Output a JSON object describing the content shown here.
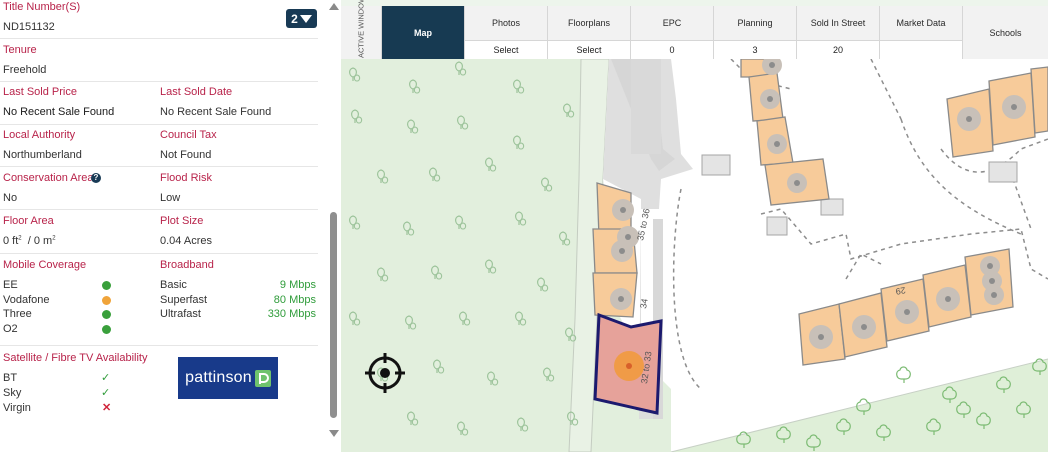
{
  "property": {
    "title_number_label": "Title Number(S)",
    "title_number_value": "ND151132",
    "title_count": "2",
    "tenure_label": "Tenure",
    "tenure_value": "Freehold",
    "last_sold_price_label": "Last Sold Price",
    "last_sold_price_value": "No Recent Sale Found",
    "last_sold_date_label": "Last Sold Date",
    "last_sold_date_value": "No Recent Sale Found",
    "local_authority_label": "Local Authority",
    "local_authority_value": "Northumberland",
    "council_tax_label": "Council Tax",
    "council_tax_value": "Not Found",
    "conservation_area_label": "Conservation Area",
    "conservation_area_value": "No",
    "flood_risk_label": "Flood Risk",
    "flood_risk_value": "Low",
    "floor_area_label": "Floor Area",
    "floor_area_ft": "0 ft",
    "floor_area_m": "/ 0 m",
    "floor_area_sup": "2",
    "plot_size_label": "Plot Size",
    "plot_size_value": "0.04 Acres"
  },
  "mobile": {
    "label": "Mobile Coverage",
    "operators": [
      {
        "name": "EE",
        "color": "#3aa03c"
      },
      {
        "name": "Vodafone",
        "color": "#f0a43a"
      },
      {
        "name": "Three",
        "color": "#3aa03c"
      },
      {
        "name": "O2",
        "color": "#3aa03c"
      }
    ]
  },
  "broadband": {
    "label": "Broadband",
    "tiers": [
      {
        "name": "Basic",
        "speed": "9 Mbps"
      },
      {
        "name": "Superfast",
        "speed": "80 Mbps"
      },
      {
        "name": "Ultrafast",
        "speed": "330 Mbps"
      }
    ]
  },
  "tv": {
    "label": "Satellite / Fibre TV Availability",
    "providers": [
      {
        "name": "BT",
        "mark": "✓"
      },
      {
        "name": "Sky",
        "mark": "✓"
      },
      {
        "name": "Virgin",
        "mark": "✕"
      }
    ]
  },
  "agent": {
    "logo_text": "pattinson"
  },
  "tabs": {
    "active_window": "ACTIVE WINDOW",
    "map": "Map",
    "photos": {
      "label": "Photos",
      "value": "Select"
    },
    "floorplans": {
      "label": "Floorplans",
      "value": "Select"
    },
    "epc": {
      "label": "EPC",
      "value": "0"
    },
    "planning": {
      "label": "Planning",
      "value": "3"
    },
    "sold_in_street": {
      "label": "Sold In Street",
      "value": "20"
    },
    "market_data": {
      "label": "Market Data",
      "value": ""
    },
    "schools": "Schools"
  },
  "map": {
    "labels": {
      "a": "35 to 36",
      "b": "34",
      "c": "32 to 33",
      "d": "29"
    },
    "colors": {
      "building": "#f7cb9a",
      "selected": "#e6a29a",
      "selected_outline": "#1c1a6e",
      "marker": "#f19a38",
      "woodland": "#e0efdb",
      "road": "#ffffff",
      "plot": "#e4e4e4"
    }
  },
  "icons": {
    "help": "question-icon",
    "locate": "crosshair-icon",
    "scroll_up": "chevron-up-icon",
    "scroll_down": "chevron-down-icon"
  }
}
